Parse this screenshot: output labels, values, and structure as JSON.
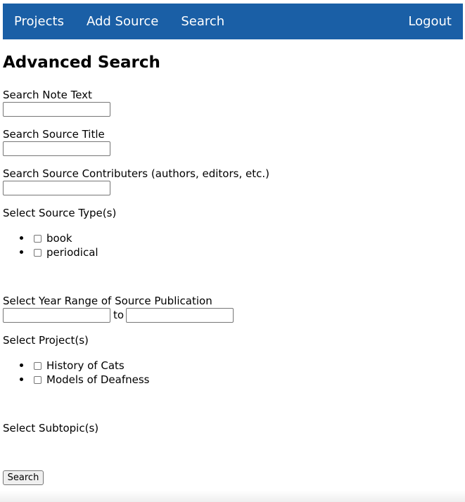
{
  "nav": {
    "projects": "Projects",
    "add_source": "Add Source",
    "search": "Search",
    "logout": "Logout"
  },
  "page_title": "Advanced Search",
  "fields": {
    "note_text_label": "Search Note Text",
    "note_text_value": "",
    "source_title_label": "Search Source Title",
    "source_title_value": "",
    "contributors_label": "Search Source Contributers (authors, editors, etc.)",
    "contributors_value": ""
  },
  "source_types": {
    "label": "Select Source Type(s)",
    "options": [
      {
        "label": "book",
        "checked": false
      },
      {
        "label": "periodical",
        "checked": false
      }
    ]
  },
  "year_range": {
    "label": "Select Year Range of Source Publication",
    "from_value": "",
    "to_word": "to",
    "to_value": ""
  },
  "projects": {
    "label": "Select Project(s)",
    "options": [
      {
        "label": "History of Cats",
        "checked": false
      },
      {
        "label": "Models of Deafness",
        "checked": false
      }
    ]
  },
  "subtopics": {
    "label": "Select Subtopic(s)"
  },
  "submit_label": "Search",
  "colors": {
    "nav_background": "#1a5fa6",
    "nav_text": "#ffffff"
  }
}
